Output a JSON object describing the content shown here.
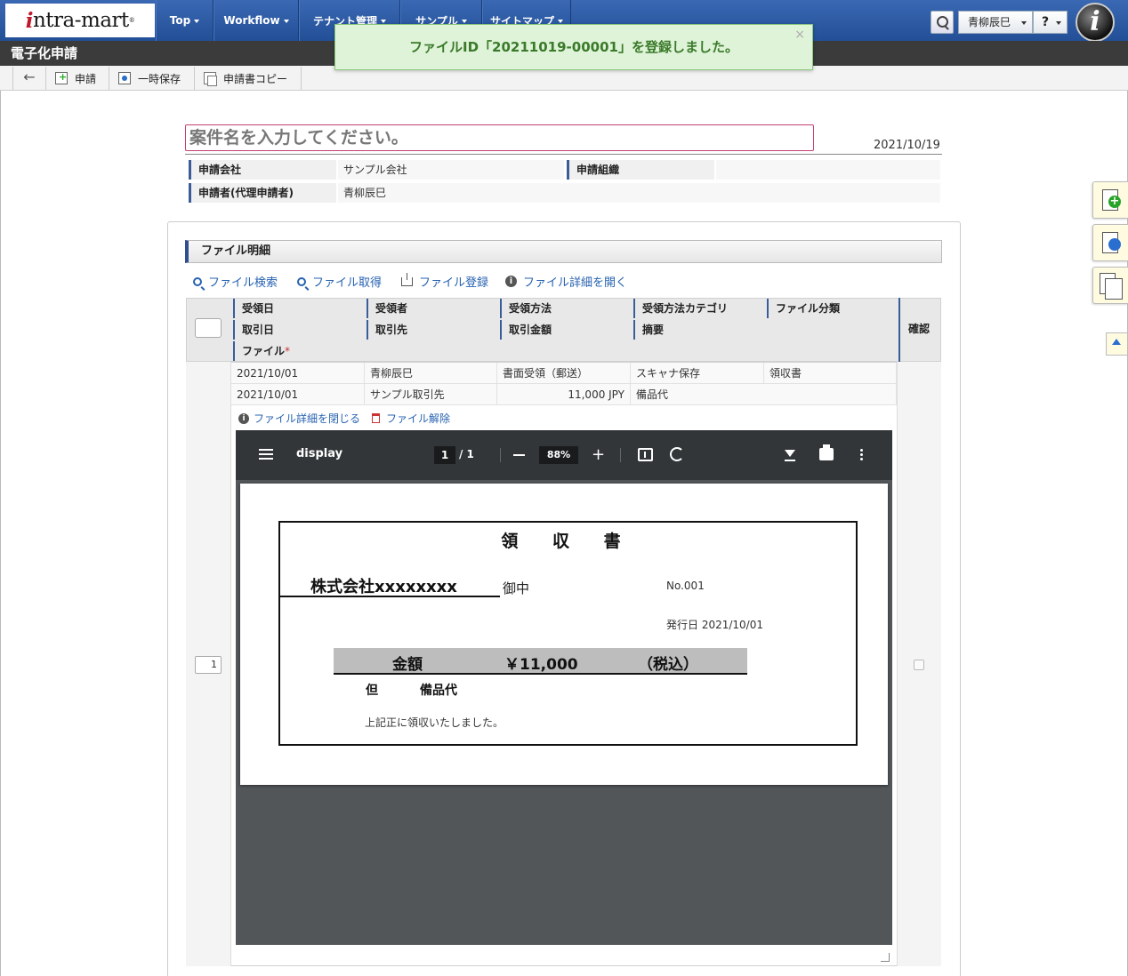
{
  "header": {
    "logo": {
      "prefix": "i",
      "text": "ntra-mart",
      "mark": "®"
    },
    "nav": [
      {
        "label": "Top"
      },
      {
        "label": "Workflow"
      },
      {
        "label": "テナント管理"
      },
      {
        "label": "サンプル"
      },
      {
        "label": "サイトマップ"
      }
    ],
    "user_name": "青柳辰巳",
    "help_label": "?",
    "brand_icon_letter": "i"
  },
  "page_title": "電子化申請",
  "toolbar": {
    "back_label": "←",
    "apply_label": "申請",
    "temp_save_label": "一時保存",
    "copy_label": "申請書コピー"
  },
  "toast": {
    "message": "ファイルID「20211019-00001」を登録しました。",
    "close": "×"
  },
  "form": {
    "case_placeholder": "案件名を入力してください。",
    "date": "2021/10/19",
    "applicant_company_label": "申請会社",
    "applicant_company": "サンプル会社",
    "applicant_org_label": "申請組織",
    "applicant_org": "",
    "applicant_label": "申請者(代理申請者)",
    "applicant": "青柳辰巳"
  },
  "file_section": {
    "title": "ファイル明細",
    "actions": [
      "ファイル検索",
      "ファイル取得",
      "ファイル登録",
      "ファイル詳細を開く"
    ],
    "headers": {
      "receipt_date": "受領日",
      "receiver": "受領者",
      "receipt_method": "受領方法",
      "receipt_method_category": "受領方法カテゴリ",
      "file_class": "ファイル分類",
      "trade_date": "取引日",
      "trade_partner": "取引先",
      "trade_amount": "取引金額",
      "summary": "摘要",
      "file": "ファイル",
      "required_mark": "*",
      "confirm": "確認"
    },
    "row": {
      "number": "1",
      "receipt_date": "2021/10/01",
      "receiver": "青柳辰巳",
      "receipt_method": "書面受領（郵送）",
      "receipt_method_category": "スキャナ保存",
      "file_class": "領収書",
      "trade_date": "2021/10/01",
      "trade_partner": "サンプル取引先",
      "trade_amount": "11,000 JPY",
      "summary": "備品代",
      "close_detail": "ファイル詳細を閉じる",
      "release": "ファイル解除"
    }
  },
  "viewer": {
    "title": "display",
    "page": "1",
    "total": "/ 1",
    "zoom": "88%",
    "plus": "+"
  },
  "receipt": {
    "title": "領 収 書",
    "company": "株式会社xxxxxxxx",
    "onchu": "御中",
    "number": "No.001",
    "issue_date": "発行日 2021/10/01",
    "amount_label": "金額",
    "amount": "￥11,000",
    "tax": "（税込）",
    "tada": "但",
    "item": "備品代",
    "thanks": "上記正に領収いたしました。"
  }
}
